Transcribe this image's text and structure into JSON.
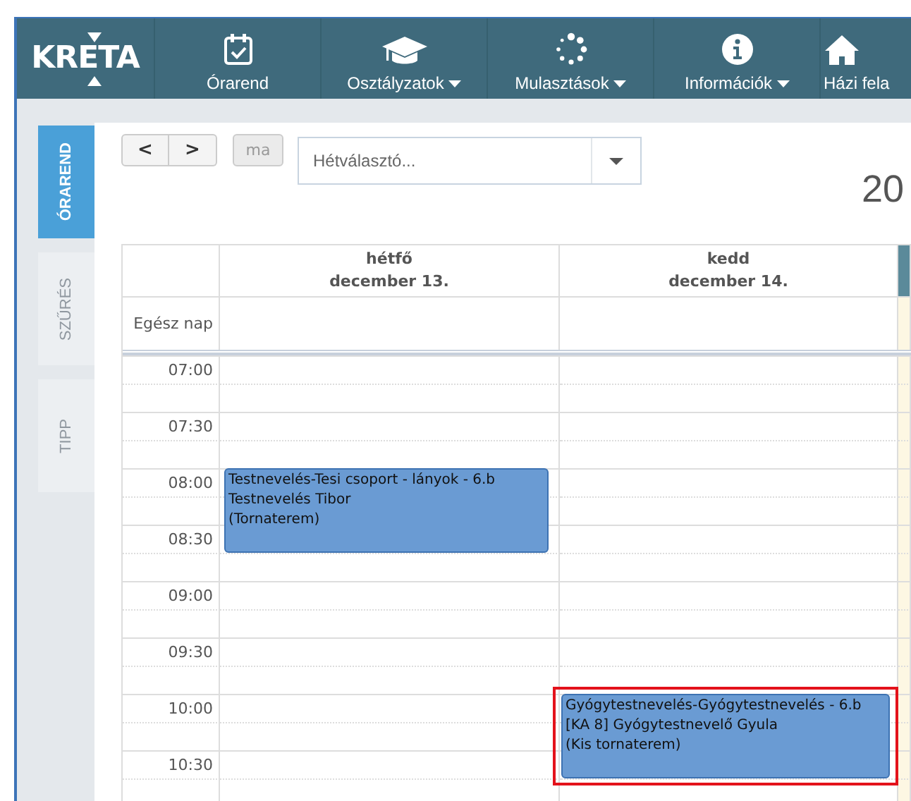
{
  "logo": {
    "text": "KRETA"
  },
  "nav": [
    {
      "label": "Órarend",
      "dropdown": false
    },
    {
      "label": "Osztályzatok",
      "dropdown": true
    },
    {
      "label": "Mulasztások",
      "dropdown": true
    },
    {
      "label": "Információk",
      "dropdown": true
    },
    {
      "label": "Házi fela",
      "dropdown": false
    }
  ],
  "side_tabs": [
    {
      "label": "ÓRAREND",
      "selected": true
    },
    {
      "label": "SZŰRÉS",
      "selected": false
    },
    {
      "label": "TIPP",
      "selected": false
    }
  ],
  "toolbar": {
    "prev": "<",
    "next": ">",
    "today": "ma",
    "week_picker": {
      "placeholder": "Hétválasztó..."
    },
    "title": "20"
  },
  "calendar": {
    "all_day_label": "Egész nap",
    "days": [
      {
        "name": "hétfő",
        "date": "december 13.",
        "today": false
      },
      {
        "name": "kedd",
        "date": "december 14.",
        "today": false
      },
      {
        "today": true
      }
    ],
    "time_slots": [
      {
        "time": "07:00",
        "cells": [
          {
            "kind": "empty"
          },
          {
            "kind": "empty"
          },
          {
            "kind": "empty"
          }
        ]
      },
      {
        "time": "07:30",
        "cells": [
          {
            "kind": "empty"
          },
          {
            "kind": "empty"
          },
          {
            "kind": "empty"
          }
        ]
      },
      {
        "time": "08:00",
        "cells": [
          {
            "kind": "lesson",
            "highlighted": false,
            "lines": [
              "Testnevelés-Tesi csoport - lányok - 6.b",
              "Testnevelés Tibor",
              "(Tornaterem)"
            ]
          },
          {
            "kind": "empty"
          },
          {
            "kind": "empty"
          }
        ]
      },
      {
        "time": "08:30",
        "cells": [
          {
            "kind": "empty"
          },
          {
            "kind": "empty"
          },
          {
            "kind": "empty"
          }
        ]
      },
      {
        "time": "09:00",
        "cells": [
          {
            "kind": "empty"
          },
          {
            "kind": "empty"
          },
          {
            "kind": "empty"
          }
        ]
      },
      {
        "time": "09:30",
        "cells": [
          {
            "kind": "empty"
          },
          {
            "kind": "empty"
          },
          {
            "kind": "empty"
          }
        ]
      },
      {
        "time": "10:00",
        "cells": [
          {
            "kind": "empty"
          },
          {
            "kind": "lesson",
            "highlighted": true,
            "lines": [
              "Gyógytestnevelés-Gyógytestnevelés - 6.b",
              "[KA 8] Gyógytestnevelő Gyula",
              "(Kis tornaterem)"
            ]
          },
          {
            "kind": "empty"
          }
        ]
      },
      {
        "time": "10:30",
        "cells": [
          {
            "kind": "empty"
          },
          {
            "kind": "empty"
          },
          {
            "kind": "empty"
          }
        ]
      }
    ]
  }
}
